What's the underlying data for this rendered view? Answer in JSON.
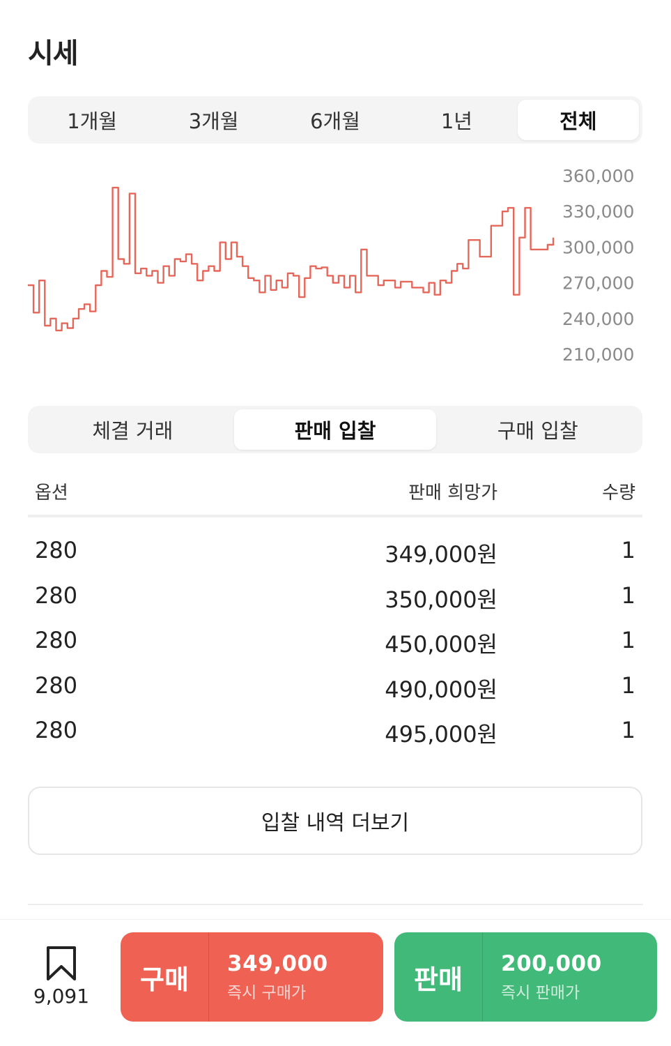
{
  "page": {
    "title": "시세"
  },
  "period_tabs": [
    {
      "label": "1개월",
      "active": false
    },
    {
      "label": "3개월",
      "active": false
    },
    {
      "label": "6개월",
      "active": false
    },
    {
      "label": "1년",
      "active": false
    },
    {
      "label": "전체",
      "active": true
    }
  ],
  "chart_data": {
    "type": "line",
    "line_style": "step",
    "color": "#e5675a",
    "y_axis_position": "right",
    "y_ticks": [
      "360,000",
      "330,000",
      "300,000",
      "270,000",
      "240,000",
      "210,000"
    ],
    "ylim": [
      210000,
      360000
    ],
    "series": [
      {
        "values": [
          268000,
          245000,
          272000,
          234000,
          240000,
          230000,
          236000,
          232000,
          240000,
          248000,
          252000,
          246000,
          268000,
          280000,
          275000,
          350000,
          290000,
          286000,
          345000,
          278000,
          282000,
          276000,
          280000,
          270000,
          284000,
          276000,
          290000,
          288000,
          294000,
          286000,
          272000,
          280000,
          284000,
          280000,
          304000,
          290000,
          304000,
          292000,
          284000,
          274000,
          272000,
          262000,
          276000,
          264000,
          272000,
          266000,
          278000,
          276000,
          258000,
          274000,
          284000,
          282000,
          283000,
          276000,
          270000,
          276000,
          266000,
          276000,
          262000,
          298000,
          276000,
          276000,
          268000,
          272000,
          272000,
          266000,
          271000,
          271000,
          266000,
          266000,
          262000,
          270000,
          260000,
          272000,
          270000,
          280000,
          286000,
          282000,
          306000,
          306000,
          292000,
          292000,
          318000,
          318000,
          330000,
          333000,
          260000,
          308000,
          333000,
          298000,
          298000,
          298000,
          302000,
          308000
        ]
      }
    ]
  },
  "trade_tabs": [
    {
      "label": "체결 거래",
      "active": false
    },
    {
      "label": "판매 입찰",
      "active": true
    },
    {
      "label": "구매 입찰",
      "active": false
    }
  ],
  "table": {
    "headers": {
      "option": "옵션",
      "price": "판매 희망가",
      "qty": "수량"
    },
    "rows": [
      {
        "option": "280",
        "price": "349,000원",
        "qty": "1"
      },
      {
        "option": "280",
        "price": "350,000원",
        "qty": "1"
      },
      {
        "option": "280",
        "price": "450,000원",
        "qty": "1"
      },
      {
        "option": "280",
        "price": "490,000원",
        "qty": "1"
      },
      {
        "option": "280",
        "price": "495,000원",
        "qty": "1"
      }
    ]
  },
  "more_button": {
    "label": "입찰 내역 더보기"
  },
  "bottom_bar": {
    "bookmark": {
      "icon": "bookmark-icon",
      "count": "9,091"
    },
    "buy": {
      "label": "구매",
      "price": "349,000",
      "sub": "즉시 구매가",
      "color": "#ef6253"
    },
    "sell": {
      "label": "판매",
      "price": "200,000",
      "sub": "즉시 판매가",
      "color": "#41b979"
    }
  }
}
